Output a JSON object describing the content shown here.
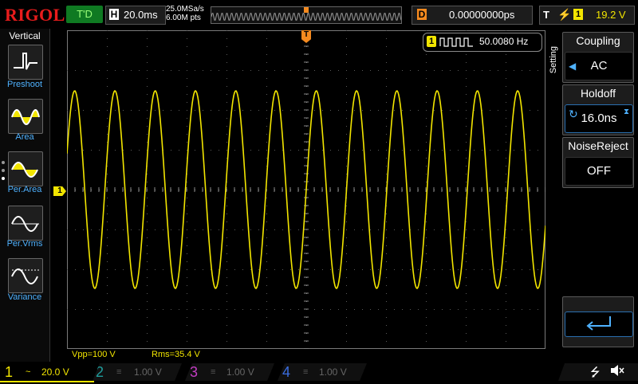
{
  "topbar": {
    "logo": "RIGOL",
    "run_status": "T'D",
    "horizontal_key": "H",
    "timebase": "20.0ms",
    "sample_rate": "25.0MSa/s",
    "memory_depth": "6.00M pts",
    "delay_key": "D",
    "delay_value": "0.00000000ps",
    "trigger_key": "T",
    "trigger_source": "1",
    "trigger_level": "19.2 V"
  },
  "left_menu": {
    "title": "Vertical",
    "items": [
      {
        "label": "Preshoot",
        "icon": "preshoot-icon"
      },
      {
        "label": "Area",
        "icon": "area-icon"
      },
      {
        "label": "Per.Area",
        "icon": "per-area-icon"
      },
      {
        "label": "Per.Vrms",
        "icon": "per-vrms-icon"
      },
      {
        "label": "Variance",
        "icon": "variance-icon"
      }
    ]
  },
  "waveform": {
    "channel_marker": "1",
    "trigger_marker": "T",
    "frequency_channel": "1",
    "frequency": "50.0080 Hz",
    "color": "#f2e500",
    "measurements": {
      "vpp": "Vpp=100 V",
      "rms": "Rms=35.4 V"
    }
  },
  "right_panel": {
    "side_label": "Setting",
    "coupling": {
      "title": "Coupling",
      "value": "AC"
    },
    "holdoff": {
      "title": "Holdoff",
      "value": "16.0ns"
    },
    "noise_reject": {
      "title": "NoiseReject",
      "value": "OFF"
    }
  },
  "bottom_bar": {
    "channels": [
      {
        "num": "1",
        "coupling": "~",
        "scale": "20.0 V",
        "color": "#f2e500",
        "active": true
      },
      {
        "num": "2",
        "coupling": "≡",
        "scale": "1.00 V",
        "color": "#1f9e9e",
        "active": false
      },
      {
        "num": "3",
        "coupling": "≡",
        "scale": "1.00 V",
        "color": "#c33dc3",
        "active": false
      },
      {
        "num": "4",
        "coupling": "≡",
        "scale": "1.00 V",
        "color": "#3a6de0",
        "active": false
      }
    ],
    "usb_icon": "usb-icon",
    "speaker_icon": "speaker-muted-icon"
  }
}
